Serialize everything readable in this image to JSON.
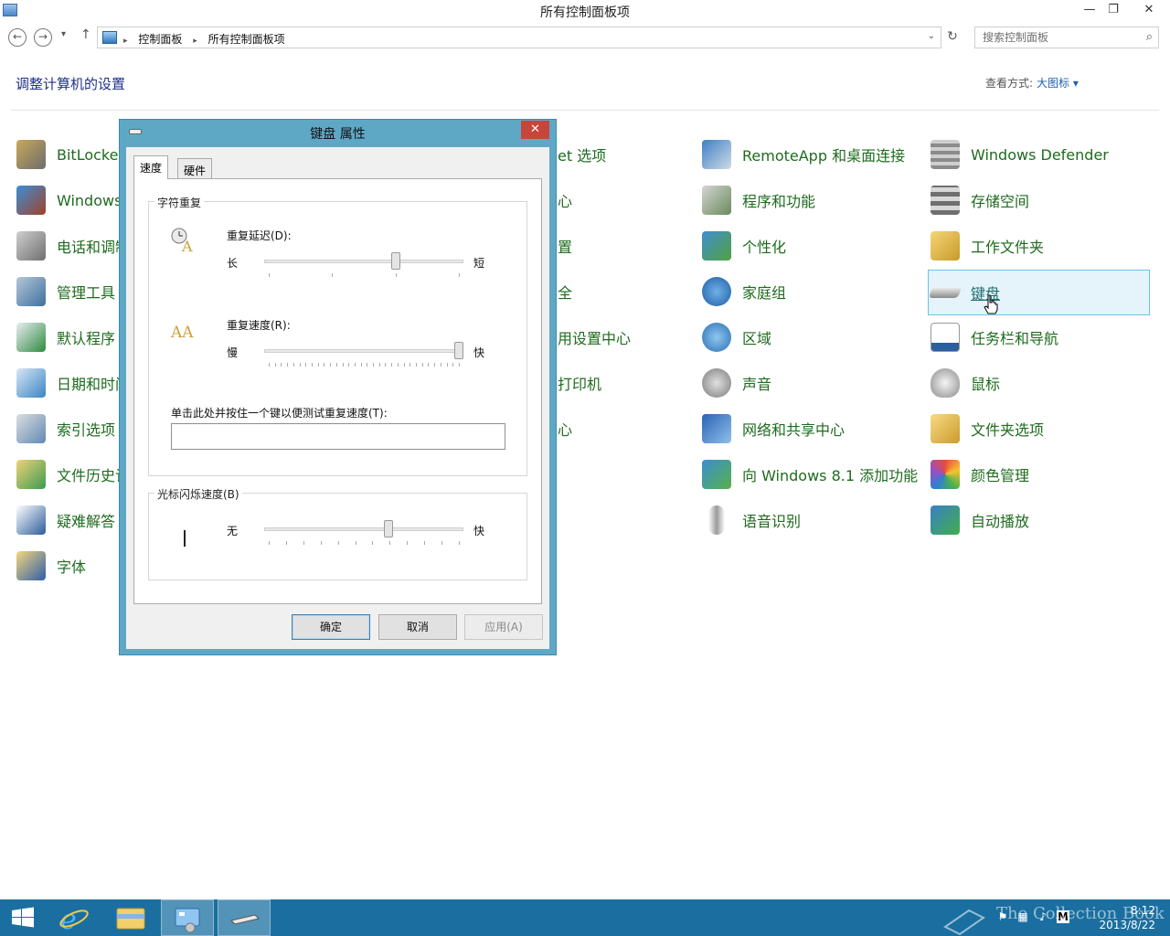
{
  "window": {
    "title": "所有控制面板项",
    "minimize": "—",
    "maximize": "❐",
    "close": "✕"
  },
  "address": {
    "crumbs": [
      "控制面板",
      "所有控制面板项"
    ],
    "search_placeholder": "搜索控制面板"
  },
  "header": {
    "title": "调整计算机的设置",
    "view_by_label": "查看方式:",
    "view_by_value": "大图标 ▾"
  },
  "items": {
    "col1": [
      "BitLocker",
      "Windows",
      "电话和调制",
      "管理工具",
      "默认程序",
      "日期和时间",
      "索引选项",
      "文件历史记",
      "疑难解答",
      "字体"
    ],
    "col2": [
      "et 选项",
      "心",
      "置",
      "全",
      "用设置中心",
      "打印机",
      "心"
    ],
    "col3": [
      "RemoteApp 和桌面连接",
      "程序和功能",
      "个性化",
      "家庭组",
      "区域",
      "声音",
      "网络和共享中心",
      "向 Windows 8.1 添加功能",
      "语音识别"
    ],
    "col4": [
      "Windows Defender",
      "存储空间",
      "工作文件夹",
      "键盘",
      "任务栏和导航",
      "鼠标",
      "文件夹选项",
      "颜色管理",
      "自动播放"
    ]
  },
  "dialog": {
    "title": "键盘 属性",
    "close": "✕",
    "tabs": [
      "速度",
      "硬件"
    ],
    "char_repeat_group": "字符重复",
    "repeat_delay_label": "重复延迟(D):",
    "repeat_delay_left": "长",
    "repeat_delay_right": "短",
    "repeat_delay_value": 0.67,
    "repeat_rate_label": "重复速度(R):",
    "repeat_rate_left": "慢",
    "repeat_rate_right": "快",
    "repeat_rate_value": 1.0,
    "test_label": "单击此处并按住一个键以便测试重复速度(T):",
    "blink_group": "光标闪烁速度(B)",
    "blink_left": "无",
    "blink_right": "快",
    "blink_value": 0.63,
    "ok": "确定",
    "cancel": "取消",
    "apply": "应用(A)"
  },
  "taskbar": {
    "clock_time": "8:12",
    "clock_date": "2013/8/22",
    "watermark": "The Collection Book"
  },
  "colors": {
    "link_green": "#1e6b1e",
    "title_blue": "#1e3287",
    "dialog_frame": "#5ea8c6",
    "taskbar": "#1a6fa0",
    "close_red": "#c7463c"
  }
}
